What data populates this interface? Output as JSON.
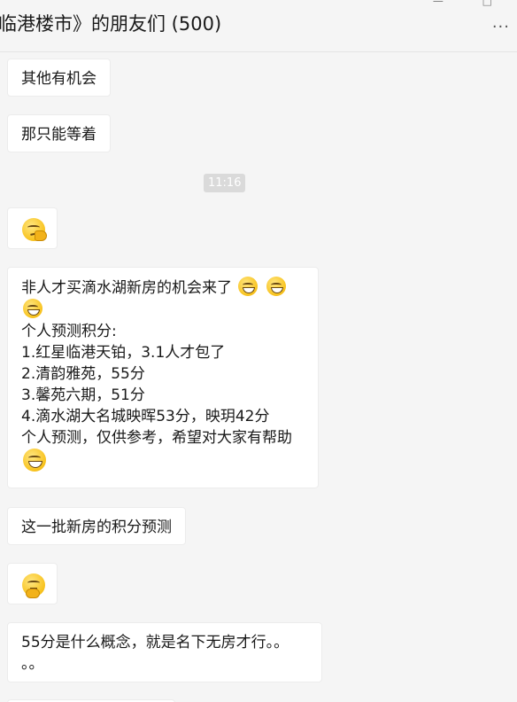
{
  "header": {
    "title": "临港楼市》的朋友们 (500)",
    "more_icon": "more-icon"
  },
  "messages": [
    {
      "text": "其他有机会"
    },
    {
      "text": "那只能等着"
    },
    {
      "icon": "smirk-emoji"
    },
    {
      "lines": [
        "非人才买滴水湖新房的机会来了",
        "个人预测积分:",
        "1.红星临港天铂，3.1人才包了",
        "2.清韵雅苑，55分",
        "3.馨苑六期，51分",
        "4.滴水湖大名城映晖53分，映玥42分",
        "个人预测，仅供参考，希望对大家有帮助"
      ],
      "icons": [
        "grin-emoji",
        "grin-emoji",
        "grin-emoji",
        "grimace-emoji"
      ]
    },
    {
      "text": "这一批新房的积分预测"
    },
    {
      "icon": "thinking-emoji"
    },
    {
      "lines": [
        "55分是什么概念，就是名下无房才行。。",
        "。。"
      ]
    }
  ],
  "timestamp": "11:16"
}
